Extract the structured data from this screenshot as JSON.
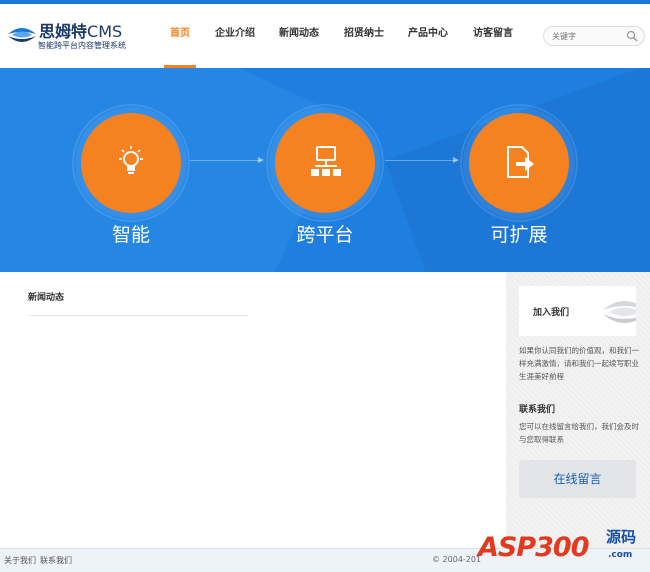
{
  "header": {
    "logo_title": "思姆特",
    "logo_cms": "CMS",
    "logo_subtitle": "智能跨平台内容管理系统",
    "nav": [
      "首页",
      "企业介绍",
      "新闻动态",
      "招贤纳士",
      "产品中心",
      "访客留言"
    ],
    "active_nav": "首页",
    "search_placeholder": "关键字"
  },
  "banner": {
    "features": [
      {
        "label": "智能",
        "icon": "lightbulb-icon"
      },
      {
        "label": "跨平台",
        "icon": "network-icon"
      },
      {
        "label": "可扩展",
        "icon": "document-arrow-icon"
      }
    ]
  },
  "main": {
    "news_title": "新闻动态"
  },
  "sidebar": {
    "join_title": "加入我们",
    "join_text": "如果你认同我们的价值观，和我们一样充满激情，请和我们一起续写职业生涯美好前程",
    "contact_title": "联系我们",
    "contact_text": "您可以在线留言给我们，我们会及时与您取得联系",
    "message_button": "在线留言"
  },
  "footer": {
    "links": [
      "关于我们",
      "联系我们"
    ],
    "copyright": "© 2004-201"
  },
  "watermark": {
    "text": "ASP300",
    "cn": "源码",
    "url": ".com"
  },
  "colors": {
    "accent": "#f58220",
    "banner_blue": "#1f7fe0",
    "brand_navy": "#1a3a6b"
  }
}
